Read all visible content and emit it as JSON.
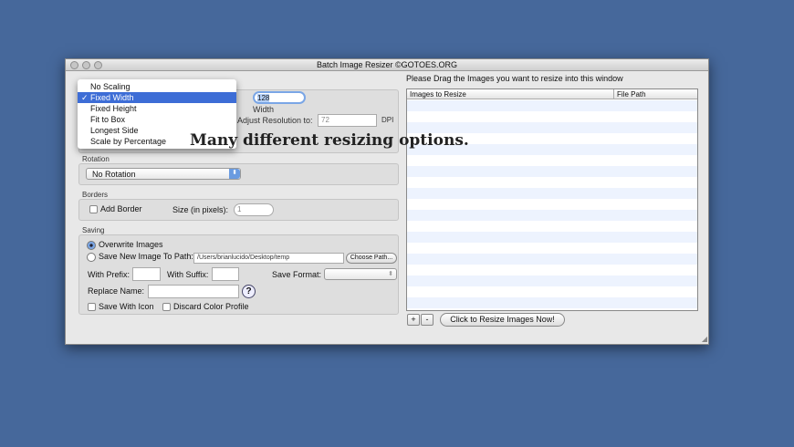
{
  "window": {
    "title": "Batch Image Resizer ©GOTOES.ORG"
  },
  "scaling": {
    "menu": [
      "No Scaling",
      "Fixed Width",
      "Fixed Height",
      "Fit to Box",
      "Longest Side",
      "Scale by Percentage"
    ],
    "selected_mark": "✓",
    "width_value": "128",
    "width_label": "Width",
    "resolution_label": "Adjust Resolution to:",
    "resolution_value": "72",
    "dpi_label": "DPI"
  },
  "rotation": {
    "label": "Rotation",
    "value": "No Rotation"
  },
  "borders": {
    "label": "Borders",
    "add_border": "Add Border",
    "size_label": "Size (in pixels):",
    "size_value": "1"
  },
  "saving": {
    "label": "Saving",
    "overwrite": "Overwrite Images",
    "save_new": "Save New Image To Path:",
    "path": "/Users/brianlucido/Desktop/temp",
    "choose_path": "Choose Path...",
    "prefix_label": "With Prefix:",
    "suffix_label": "With Suffix:",
    "format_label": "Save Format:",
    "replace_label": "Replace Name:",
    "help": "?",
    "save_icon": "Save With Icon",
    "discard_profile": "Discard Color Profile"
  },
  "right": {
    "instruction": "Please Drag the Images you want to resize into this window",
    "col_images": "Images to Resize",
    "col_path": "File Path",
    "add": "+",
    "remove": "-",
    "resize_button": "Click to Resize Images Now!"
  },
  "overlay_caption": "Many different resizing options."
}
